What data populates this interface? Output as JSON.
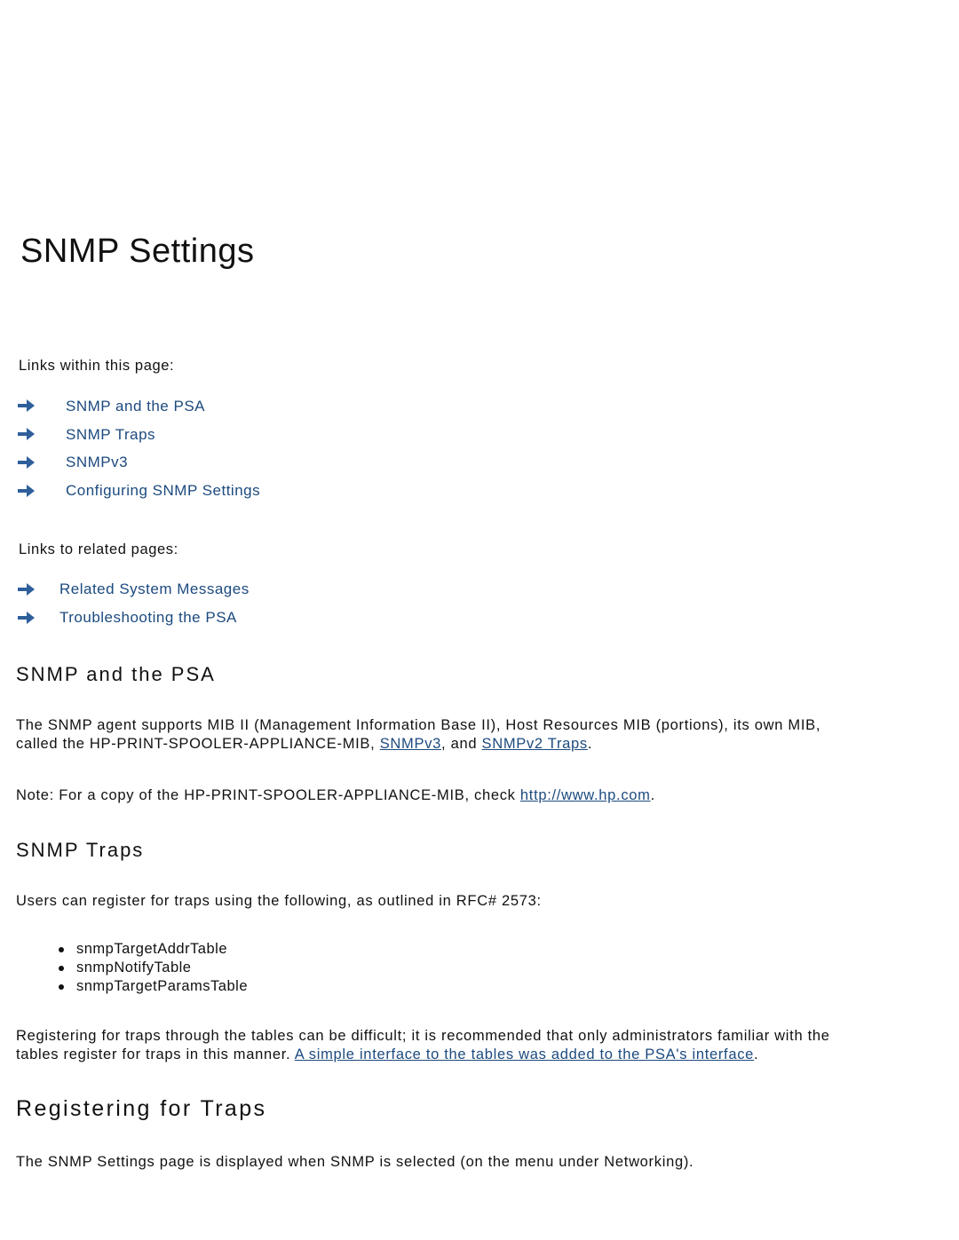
{
  "page": {
    "title": "SNMP Settings"
  },
  "links_within": {
    "label": "Links within this page:",
    "items": [
      {
        "label": "SNMP and the PSA",
        "icon": "arrow-right-icon"
      },
      {
        "label": "SNMP Traps",
        "icon": "arrow-right-icon"
      },
      {
        "label": "SNMPv3",
        "icon": "arrow-right-icon"
      },
      {
        "label": "Configuring SNMP Settings",
        "icon": "arrow-right-icon"
      }
    ]
  },
  "links_related": {
    "label": "Links to related pages:",
    "items": [
      {
        "label": "Related System Messages",
        "icon": "arrow-right-icon"
      },
      {
        "label": "Troubleshooting the PSA",
        "icon": "arrow-right-icon"
      }
    ]
  },
  "section_psa": {
    "heading": "SNMP and the PSA",
    "para1_part1": "The SNMP agent supports MIB II (Management Information Base II), Host Resources MIB (portions), its own MIB,",
    "para1_part2": "called the HP-PRINT-SPOOLER-APPLIANCE-MIB, ",
    "link_snmpv3": "SNMPv3",
    "para1_part3": ", and ",
    "link_snmpv2traps": "SNMPv2 Traps",
    "para1_part4": ".",
    "note_text": "Note: For a copy of the HP-PRINT-SPOOLER-APPLIANCE-MIB, check ",
    "note_link": "http://www.hp.com",
    "note_end": "."
  },
  "section_traps": {
    "heading": "SNMP Traps",
    "intro": "Users can register for traps using the following, as outlined in RFC# 2573:",
    "bullets": [
      "snmpTargetAddrTable",
      "snmpNotifyTable",
      "snmpTargetParamsTable"
    ],
    "para_line1": "Registering for traps through the tables can be difficult; it is recommended that only administrators familiar with the",
    "para_line2": "tables register for traps in this manner. ",
    "para_link": "A simple interface to the tables was added to the PSA's interface",
    "para_end": "."
  },
  "section_register": {
    "heading": "Registering for Traps",
    "text": "The SNMP Settings page is displayed when SNMP is selected (on the menu under Networking)."
  },
  "colors": {
    "link": "#1c4a7e",
    "arrow": "#2f5f9a",
    "text": "#111111"
  }
}
